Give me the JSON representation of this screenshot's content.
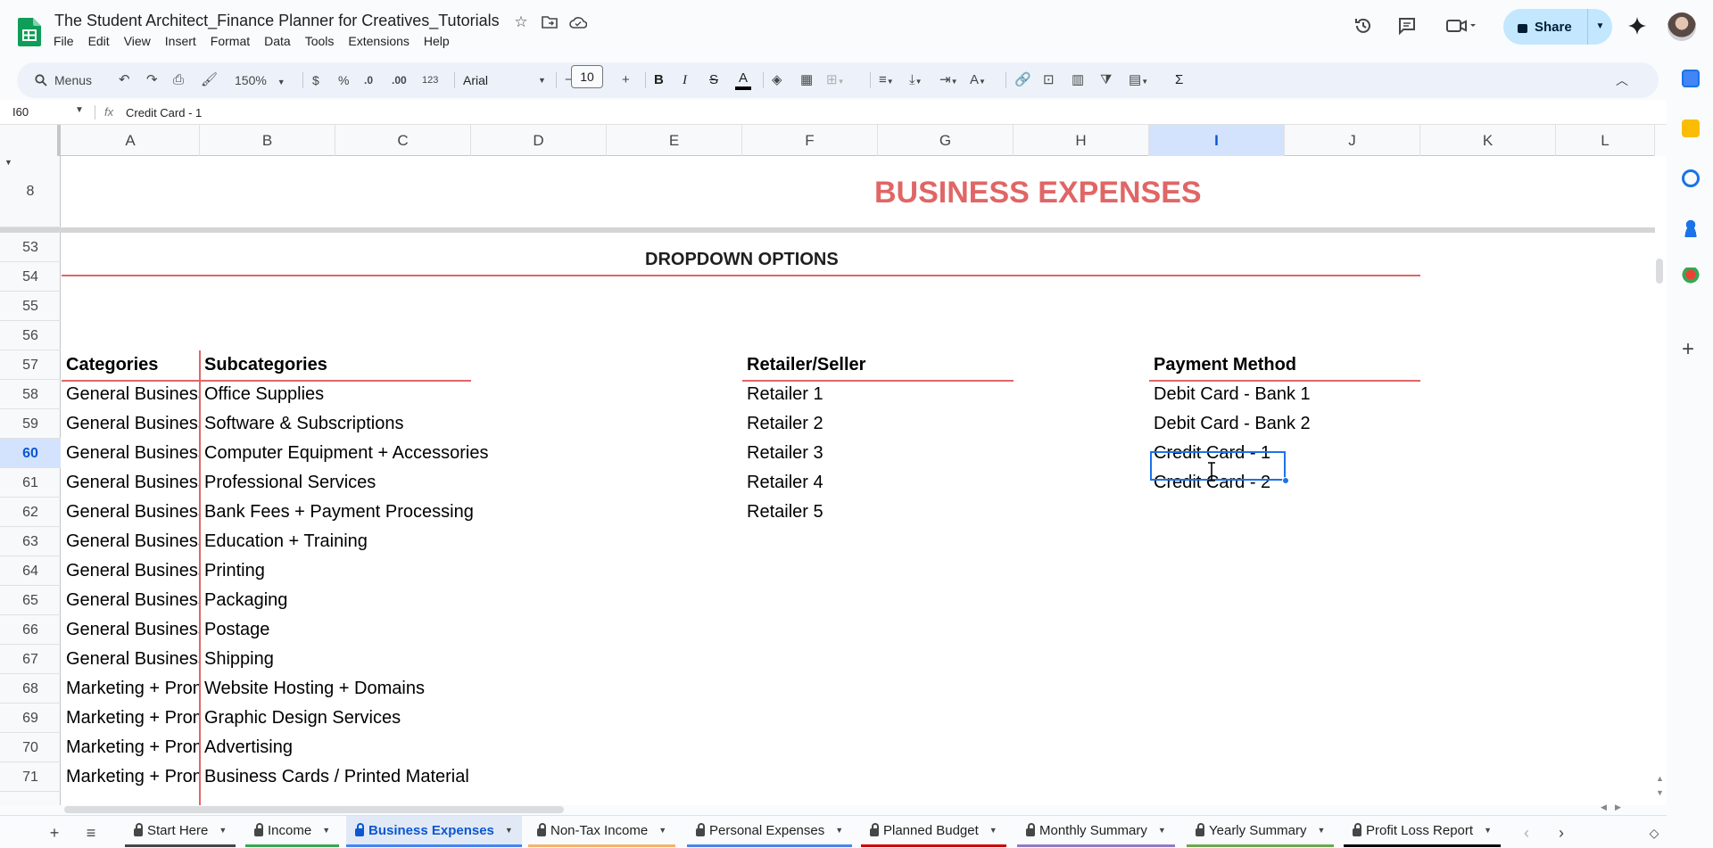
{
  "doc": {
    "title": "The Student Architect_Finance Planner for Creatives_Tutorials",
    "share_label": "Share"
  },
  "menus": [
    "File",
    "Edit",
    "View",
    "Insert",
    "Format",
    "Data",
    "Tools",
    "Extensions",
    "Help"
  ],
  "toolbar": {
    "search_label": "Menus",
    "zoom": "150%",
    "currency": "$",
    "percent": "%",
    "decrease_decimal": ".0",
    "increase_decimal": ".00",
    "number_format": "123",
    "font": "Arial",
    "font_size": "10",
    "bold": "B",
    "italic": "I",
    "strikethrough": "S",
    "text_color": "A",
    "sum": "Σ"
  },
  "formula_bar": {
    "cell_ref": "I60",
    "fx": "fx",
    "value": "Credit Card - 1"
  },
  "columns": [
    "A",
    "B",
    "C",
    "D",
    "E",
    "F",
    "G",
    "H",
    "I",
    "J",
    "K",
    "L"
  ],
  "selected_column": "I",
  "rows": [
    "8",
    "53",
    "54",
    "55",
    "56",
    "57",
    "58",
    "59",
    "60",
    "61",
    "62",
    "63",
    "64",
    "65",
    "66",
    "67",
    "68",
    "69",
    "70",
    "71"
  ],
  "selected_row": "60",
  "sheet": {
    "title": "BUSINESS EXPENSES",
    "dropdown_title": "DROPDOWN OPTIONS",
    "headers": {
      "categories": "Categories",
      "subcategories": "Subcategories",
      "retailer": "Retailer/Seller",
      "payment": "Payment Method"
    },
    "categories": [
      "General Business",
      "General Business",
      "General Business",
      "General Business",
      "General Business",
      "General Business",
      "General Business",
      "General Business",
      "General Business",
      "General Business",
      "Marketing + Promotion",
      "Marketing + Promotion",
      "Marketing + Promotion",
      "Marketing + Promotion"
    ],
    "subcategories": [
      "Office Supplies",
      "Software & Subscriptions",
      "Computer Equipment + Accessories",
      "Professional Services",
      "Bank Fees + Payment Processing",
      "Education + Training",
      "Printing",
      "Packaging",
      "Postage",
      "Shipping",
      "Website Hosting + Domains",
      "Graphic Design Services",
      "Advertising",
      "Business Cards / Printed Material"
    ],
    "retailers": [
      "Retailer 1",
      "Retailer 2",
      "Retailer 3",
      "Retailer 4",
      "Retailer 5"
    ],
    "payment_methods": [
      "Debit Card - Bank 1",
      "Debit Card - Bank 2",
      "Credit Card - 1",
      "Credit Card - 2"
    ]
  },
  "tabs": [
    {
      "label": "Start Here",
      "color": "#444746"
    },
    {
      "label": "Income",
      "color": "#34a853"
    },
    {
      "label": "Business Expenses",
      "color": "#4285f4"
    },
    {
      "label": "Non-Tax Income",
      "color": "#f6b26b"
    },
    {
      "label": "Personal Expenses",
      "color": "#4a86e8"
    },
    {
      "label": "Planned Budget",
      "color": "#cc0000"
    },
    {
      "label": "Monthly Summary",
      "color": "#8e7cc3"
    },
    {
      "label": "Yearly Summary",
      "color": "#6aa84f"
    },
    {
      "label": "Profit Loss Report",
      "color": "#000000"
    }
  ],
  "active_tab": "Business Expenses",
  "colors": {
    "accent": "#1a73e8",
    "title_red": "#e06666",
    "share_bg": "#c2e7ff"
  }
}
